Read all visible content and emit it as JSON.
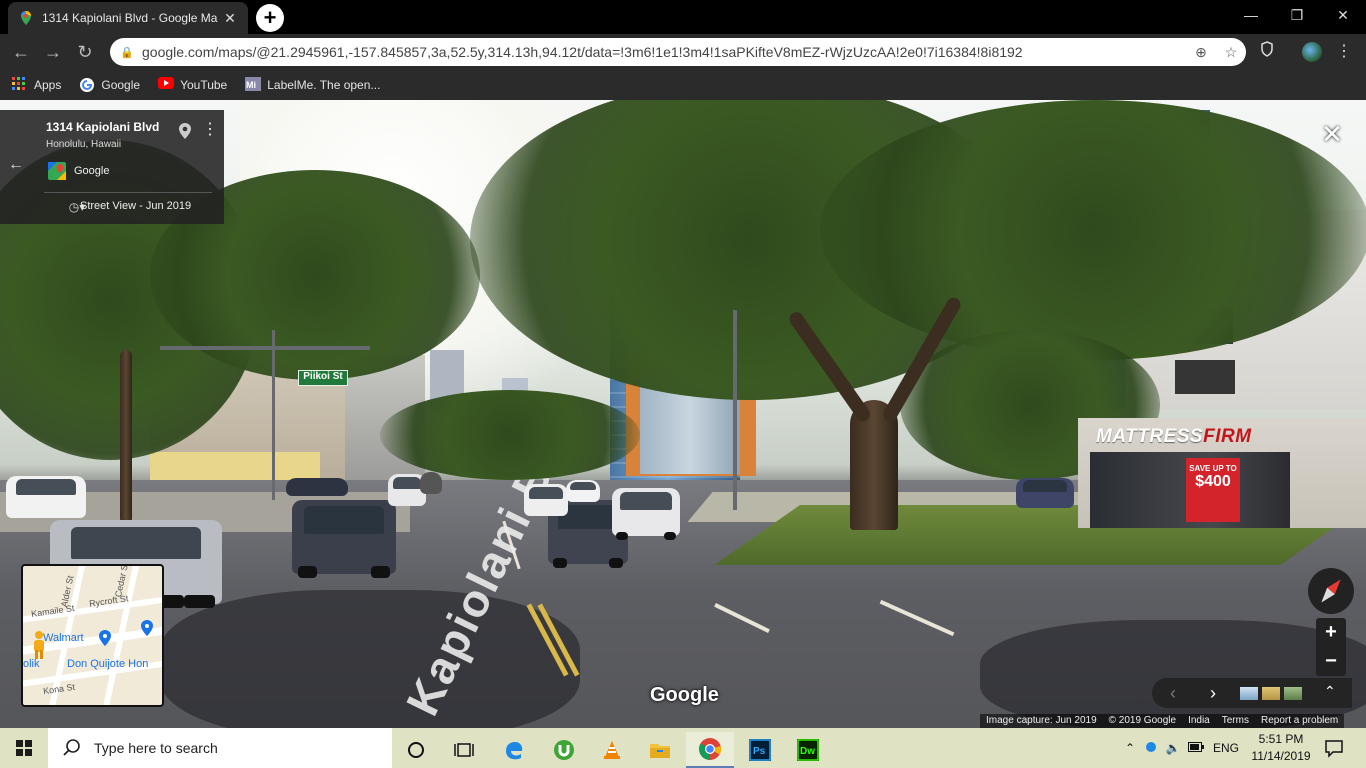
{
  "browser": {
    "tab_title": "1314 Kapiolani Blvd - Google Ma",
    "tab_close": "✕",
    "new_tab": "+",
    "window_controls": {
      "minimize": "—",
      "maximize": "❐",
      "close": "✕"
    },
    "url": "google.com/maps/@21.2945961,-157.845857,3a,52.5y,314.13h,94.12t/data=!3m6!1e1!3m4!1saPKifteV8mEZ-rWjzUzcAA!2e0!7i16384!8i8192",
    "bookmarks": [
      {
        "label": "Apps",
        "icon": "apps-grid-icon"
      },
      {
        "label": "Google",
        "icon": "google-icon"
      },
      {
        "label": "YouTube",
        "icon": "youtube-icon"
      },
      {
        "label": "LabelMe. The open...",
        "icon": "labelme-icon"
      }
    ]
  },
  "streetview": {
    "place_name": "1314 Kapiolani Blvd",
    "place_sub": "Honolulu, Hawaii",
    "contributor": "Google",
    "date_label": "Street View - Jun 2019",
    "close": "✕",
    "watermark": "Google",
    "street_sign": "Piikoi St",
    "road_marking": "Kapiolani Blvd",
    "store_sign_1": "MATTRESS",
    "store_sign_2": "FIRM",
    "promo_small": "SAVE UP TO",
    "promo_big": "$400",
    "minimap": {
      "streets": [
        "Kamaile St",
        "Rycroft St",
        "Kona St",
        "Alder St",
        "Cedar St"
      ],
      "pois": [
        "Walmart",
        "Don Quijote Hon",
        "olik"
      ]
    },
    "zoom_in": "+",
    "zoom_out": "−",
    "attribution": [
      "Image capture: Jun 2019",
      "© 2019 Google",
      "India",
      "Terms",
      "Report a problem"
    ]
  },
  "taskbar": {
    "search_placeholder": "Type here to search",
    "language": "ENG",
    "time": "5:51 PM",
    "date": "11/14/2019"
  }
}
